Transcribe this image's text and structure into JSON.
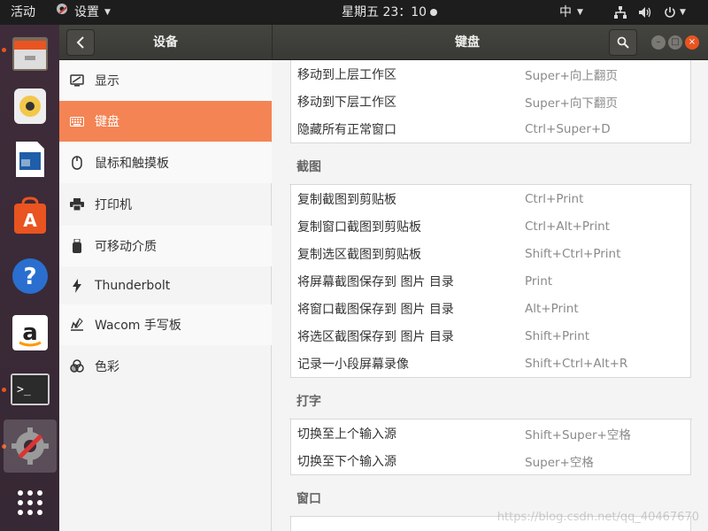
{
  "topbar": {
    "activities": "活动",
    "app_name": "设置",
    "clock": "星期五 23：10",
    "input_method": "中"
  },
  "header": {
    "left_title": "设备",
    "main_title": "键盘"
  },
  "sidebar": {
    "items": [
      {
        "label": "显示",
        "icon": "display-icon"
      },
      {
        "label": "键盘",
        "icon": "keyboard-icon"
      },
      {
        "label": "鼠标和触摸板",
        "icon": "mouse-icon"
      },
      {
        "label": "打印机",
        "icon": "printer-icon"
      },
      {
        "label": "可移动介质",
        "icon": "usb-icon"
      },
      {
        "label": "Thunderbolt",
        "icon": "thunderbolt-icon"
      },
      {
        "label": "Wacom 手写板",
        "icon": "tablet-icon"
      },
      {
        "label": "色彩",
        "icon": "color-icon"
      }
    ]
  },
  "shortcuts": {
    "nav": [
      {
        "name": "移动到上层工作区",
        "key": "Super+向上翻页"
      },
      {
        "name": "移动到下层工作区",
        "key": "Super+向下翻页"
      },
      {
        "name": "隐藏所有正常窗口",
        "key": "Ctrl+Super+D"
      }
    ],
    "screenshot_title": "截图",
    "screenshot": [
      {
        "name": "复制截图到剪贴板",
        "key": "Ctrl+Print"
      },
      {
        "name": "复制窗口截图到剪贴板",
        "key": "Ctrl+Alt+Print"
      },
      {
        "name": "复制选区截图到剪贴板",
        "key": "Shift+Ctrl+Print"
      },
      {
        "name": "将屏幕截图保存到 图片 目录",
        "key": "Print"
      },
      {
        "name": "将窗口截图保存到 图片 目录",
        "key": "Alt+Print"
      },
      {
        "name": "将选区截图保存到 图片 目录",
        "key": "Shift+Print"
      },
      {
        "name": "记录一小段屏幕录像",
        "key": "Shift+Ctrl+Alt+R"
      }
    ],
    "typing_title": "打字",
    "typing": [
      {
        "name": "切换至上个输入源",
        "key": "Shift+Super+空格"
      },
      {
        "name": "切换至下个输入源",
        "key": "Super+空格"
      }
    ],
    "windows_title": "窗口"
  },
  "watermark": "https://blog.csdn.net/qq_40467670",
  "colors": {
    "accent": "#e95420",
    "selected": "#f48454",
    "header": "#3c3b37",
    "dock": "#3b2a35"
  }
}
